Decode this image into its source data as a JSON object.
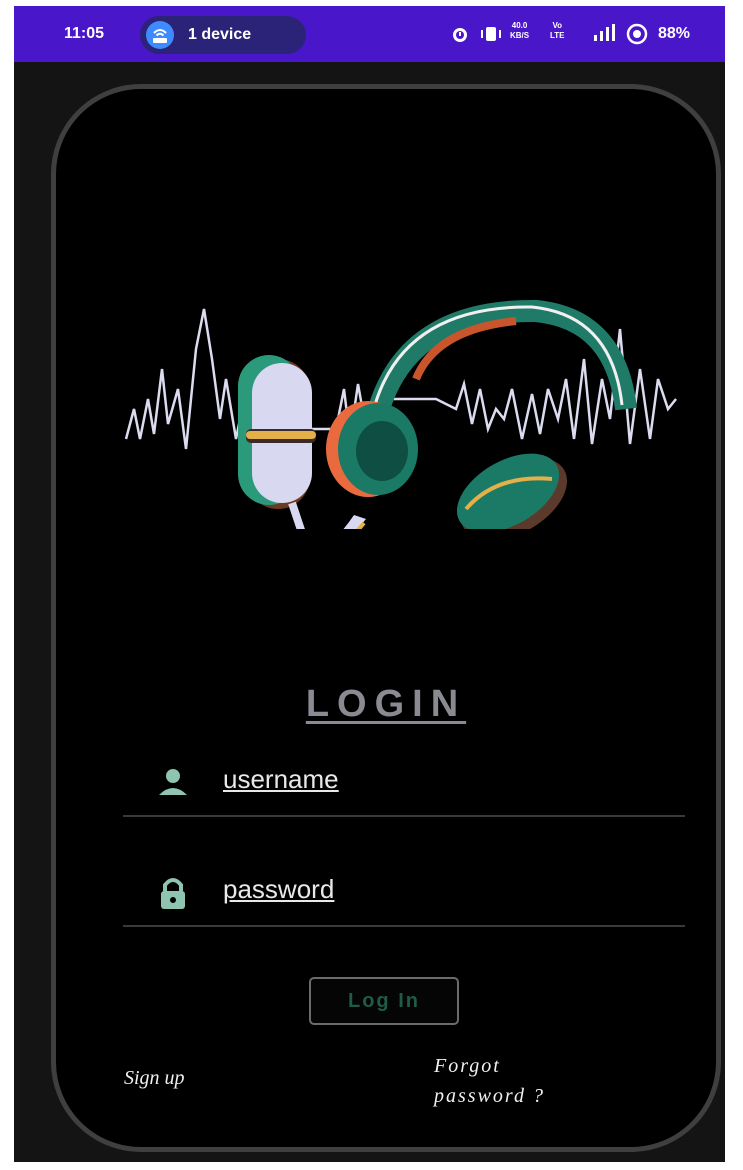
{
  "status_bar": {
    "time": "11:05",
    "chip_label": "1 device",
    "speed_top": "40.0",
    "speed_bottom": "KB/S",
    "net_top": "Vo",
    "net_bottom": "LTE",
    "battery": "88%"
  },
  "login": {
    "title": "LOGIN",
    "username_placeholder": "username",
    "password_placeholder": "password",
    "login_button": "Log In",
    "signup_link": "Sign up",
    "forgot_line1": "Forgot",
    "forgot_line2": "password ?"
  },
  "colors": {
    "status_bar": "#4a16c9",
    "background": "#000000",
    "icon_teal": "#8fc4b0",
    "button_text": "#1f5b45"
  },
  "icons": [
    "alarm-icon",
    "vibrate-icon",
    "signal-icon",
    "battery-saver-icon",
    "person-icon",
    "lock-icon"
  ]
}
